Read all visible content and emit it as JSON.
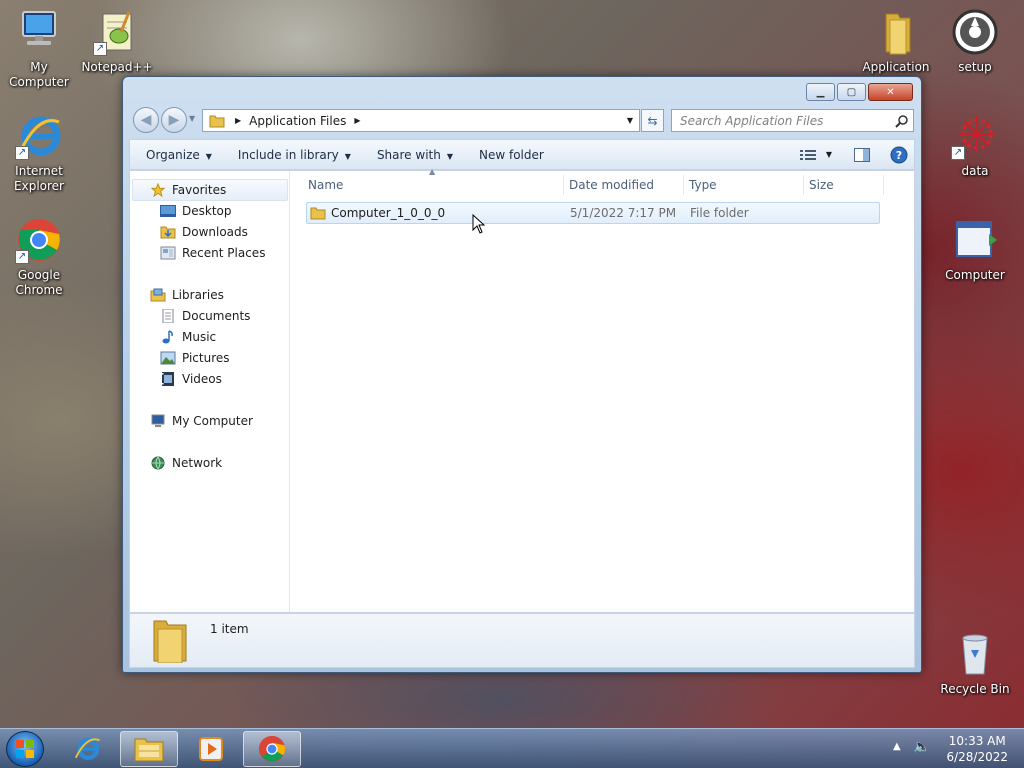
{
  "desktop": {
    "icons": {
      "my_computer": "My Computer",
      "notepadpp": "Notepad++",
      "application": "Application",
      "setup": "setup",
      "internet_explorer": "Internet Explorer",
      "data": "data",
      "google_chrome": "Google Chrome",
      "computer": "Computer",
      "recycle_bin": "Recycle Bin"
    }
  },
  "window": {
    "breadcrumb": "Application Files",
    "search_placeholder": "Search Application Files",
    "toolbar": {
      "organize": "Organize",
      "include_in_library": "Include in library",
      "share_with": "Share with",
      "new_folder": "New folder"
    },
    "nav": {
      "favorites": "Favorites",
      "desktop": "Desktop",
      "downloads": "Downloads",
      "recent_places": "Recent Places",
      "libraries": "Libraries",
      "documents": "Documents",
      "music": "Music",
      "pictures": "Pictures",
      "videos": "Videos",
      "my_computer": "My Computer",
      "network": "Network"
    },
    "columns": {
      "name": "Name",
      "date_modified": "Date modified",
      "type": "Type",
      "size": "Size"
    },
    "files": [
      {
        "name": "Computer_1_0_0_0",
        "date_modified": "5/1/2022 7:17 PM",
        "type": "File folder",
        "size": ""
      }
    ],
    "status": "1 item"
  },
  "taskbar": {
    "time": "10:33 AM",
    "date": "6/28/2022"
  },
  "colors": {
    "folder_yellow": "#e8c24a",
    "selection_border": "#b8d6f4",
    "window_frame": "#b9d1ea",
    "help_blue": "#2f6fc1"
  }
}
